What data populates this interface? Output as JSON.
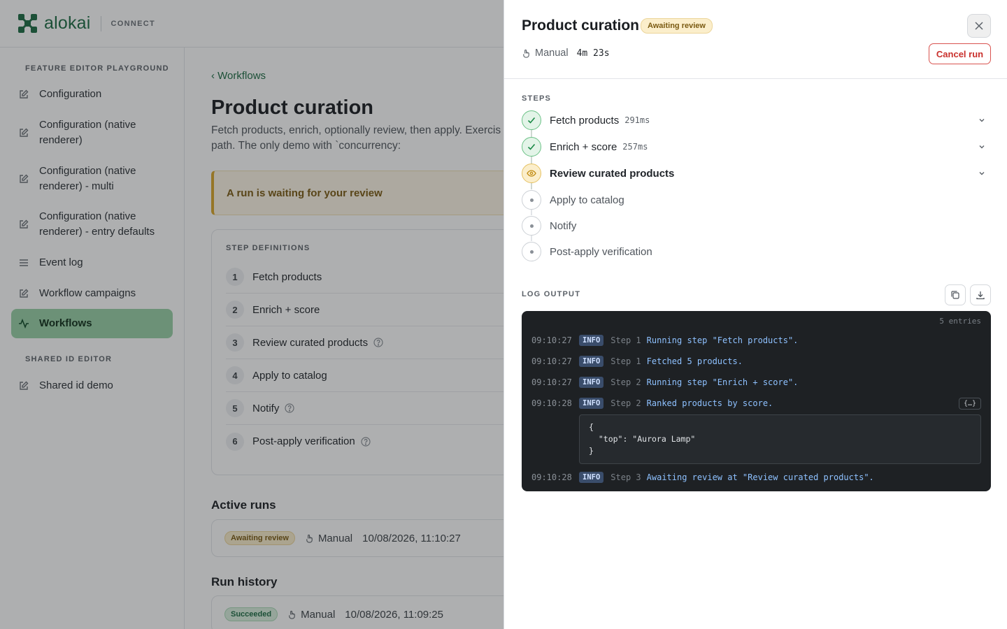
{
  "app": {
    "brand": "alokai",
    "brand_sub": "CONNECT"
  },
  "sidebar": {
    "section1": "FEATURE EDITOR PLAYGROUND",
    "items": [
      {
        "label": "Configuration",
        "icon": "edit-icon"
      },
      {
        "label": "Configuration (native renderer)",
        "icon": "edit-icon"
      },
      {
        "label": "Configuration (native renderer) - multi",
        "icon": "edit-icon"
      },
      {
        "label": "Configuration (native renderer) - entry defaults",
        "icon": "edit-icon"
      },
      {
        "label": "Event log",
        "icon": "list-icon"
      },
      {
        "label": "Workflow campaigns",
        "icon": "edit-icon"
      },
      {
        "label": "Workflows",
        "icon": "activity-icon",
        "active": true
      }
    ],
    "section2": "SHARED ID EDITOR",
    "items2": [
      {
        "label": "Shared id demo",
        "icon": "edit-icon"
      }
    ]
  },
  "main": {
    "breadcrumb": "‹ Workflows",
    "title": "Product curation",
    "description": "Fetch products, enrich, optionally review, then apply. Exercis view, and a failure path. The only demo with `concurrency:",
    "alert": "A run is waiting for your review",
    "step_definitions": {
      "heading": "STEP DEFINITIONS",
      "steps": [
        {
          "num": "1",
          "name": "Fetch products",
          "help": false
        },
        {
          "num": "2",
          "name": "Enrich + score",
          "help": false
        },
        {
          "num": "3",
          "name": "Review curated products",
          "help": true
        },
        {
          "num": "4",
          "name": "Apply to catalog",
          "help": false
        },
        {
          "num": "5",
          "name": "Notify",
          "help": true
        },
        {
          "num": "6",
          "name": "Post-apply verification",
          "help": true
        }
      ]
    },
    "active_runs": {
      "heading": "Active runs",
      "status": "Awaiting review",
      "trigger": "Manual",
      "time": "10/08/2026, 11:10:27"
    },
    "run_history": {
      "heading": "Run history",
      "status": "Succeeded",
      "trigger": "Manual",
      "time": "10/08/2026, 11:09:25"
    }
  },
  "drawer": {
    "title": "Product curation",
    "status": "Awaiting review",
    "trigger": "Manual",
    "duration": "4m 23s",
    "cancel_label": "Cancel run",
    "steps_heading": "STEPS",
    "steps": [
      {
        "name": "Fetch products",
        "time": "291ms",
        "state": "done"
      },
      {
        "name": "Enrich + score",
        "time": "257ms",
        "state": "done"
      },
      {
        "name": "Review curated products",
        "time": "",
        "state": "review"
      },
      {
        "name": "Apply to catalog",
        "time": "",
        "state": "pending"
      },
      {
        "name": "Notify",
        "time": "",
        "state": "pending"
      },
      {
        "name": "Post-apply verification",
        "time": "",
        "state": "pending"
      }
    ],
    "log_heading": "LOG OUTPUT",
    "log_count": "5 entries",
    "log": [
      {
        "ts": "09:10:27",
        "level": "INFO",
        "step": "Step 1",
        "msg": "Running step \"Fetch products\"."
      },
      {
        "ts": "09:10:27",
        "level": "INFO",
        "step": "Step 1",
        "msg": "Fetched 5 products."
      },
      {
        "ts": "09:10:27",
        "level": "INFO",
        "step": "Step 2",
        "msg": "Running step \"Enrich + score\"."
      },
      {
        "ts": "09:10:28",
        "level": "INFO",
        "step": "Step 2",
        "msg": "Ranked products by score."
      },
      {
        "ts": "09:10:28",
        "level": "INFO",
        "step": "Step 3",
        "msg": "Awaiting review at \"Review curated products\"."
      }
    ],
    "json_toggle": "{…}",
    "json_payload": "{\n  \"top\": \"Aurora Lamp\"\n}"
  }
}
